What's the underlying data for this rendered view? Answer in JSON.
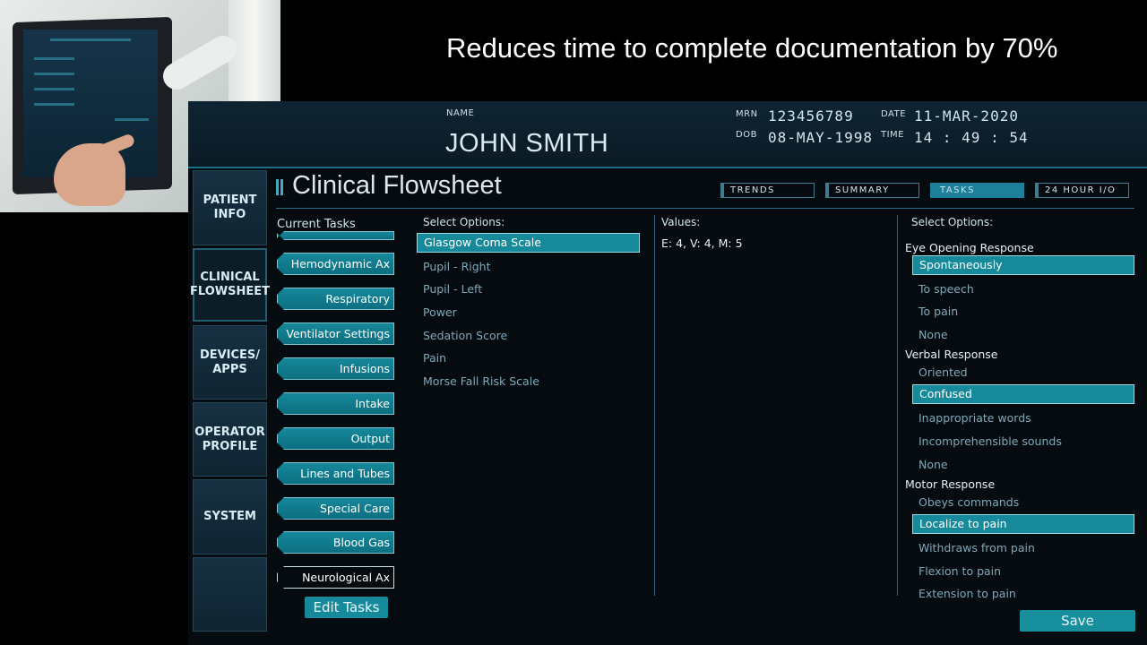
{
  "headline": "Reduces time to complete documentation by 70%",
  "patient": {
    "name_label": "NAME",
    "name": "JOHN SMITH",
    "mrn_label": "MRN",
    "mrn": "123456789",
    "dob_label": "DOB",
    "dob": "08-MAY-1998",
    "date_label": "DATE",
    "date": "11-MAR-2020",
    "time_label": "TIME",
    "time": "14 : 49 : 54"
  },
  "nav": [
    {
      "line1": "PATIENT",
      "line2": "INFO"
    },
    {
      "line1": "CLINICAL",
      "line2": "FLOWSHEET"
    },
    {
      "line1": "DEVICES/",
      "line2": "APPS"
    },
    {
      "line1": "OPERATOR",
      "line2": "PROFILE"
    },
    {
      "line1": "SYSTEM",
      "line2": ""
    }
  ],
  "page_title": "Clinical Flowsheet",
  "tabs": [
    "TRENDS",
    "SUMMARY",
    "TASKS",
    "24 HOUR I/O"
  ],
  "current_tasks_label": "Current Tasks",
  "tasks": [
    "Hemodynamic Ax",
    "Respiratory",
    "Ventilator Settings",
    "Infusions",
    "Intake",
    "Output",
    "Lines and Tubes",
    "Special Care",
    "Blood Gas",
    "Neurological Ax"
  ],
  "edit_tasks": "Edit Tasks",
  "select_options_label": "Select Options:",
  "options": [
    "Glasgow Coma Scale",
    "Pupil - Right",
    "Pupil - Left",
    "Power",
    "Sedation Score",
    "Pain",
    "Morse Fall Risk Scale"
  ],
  "values_label": "Values:",
  "values_text": "E: 4, V: 4, M: 5",
  "right_options_label": "Select Options:",
  "eye": {
    "label": "Eye Opening Response",
    "items": [
      "Spontaneously",
      "To speech",
      "To pain",
      "None"
    ]
  },
  "verbal": {
    "label": "Verbal Response",
    "items": [
      "Oriented",
      "Confused",
      "Inappropriate words",
      "Incomprehensible sounds",
      "None"
    ]
  },
  "motor": {
    "label": "Motor Response",
    "items": [
      "Obeys commands",
      "Localize to pain",
      "Withdraws from pain",
      "Flexion to pain",
      "Extension to pain"
    ]
  },
  "save": "Save",
  "colors": {
    "accent": "#168a9a",
    "header_bg": "#0e2331",
    "nav_bg": "#163142"
  }
}
